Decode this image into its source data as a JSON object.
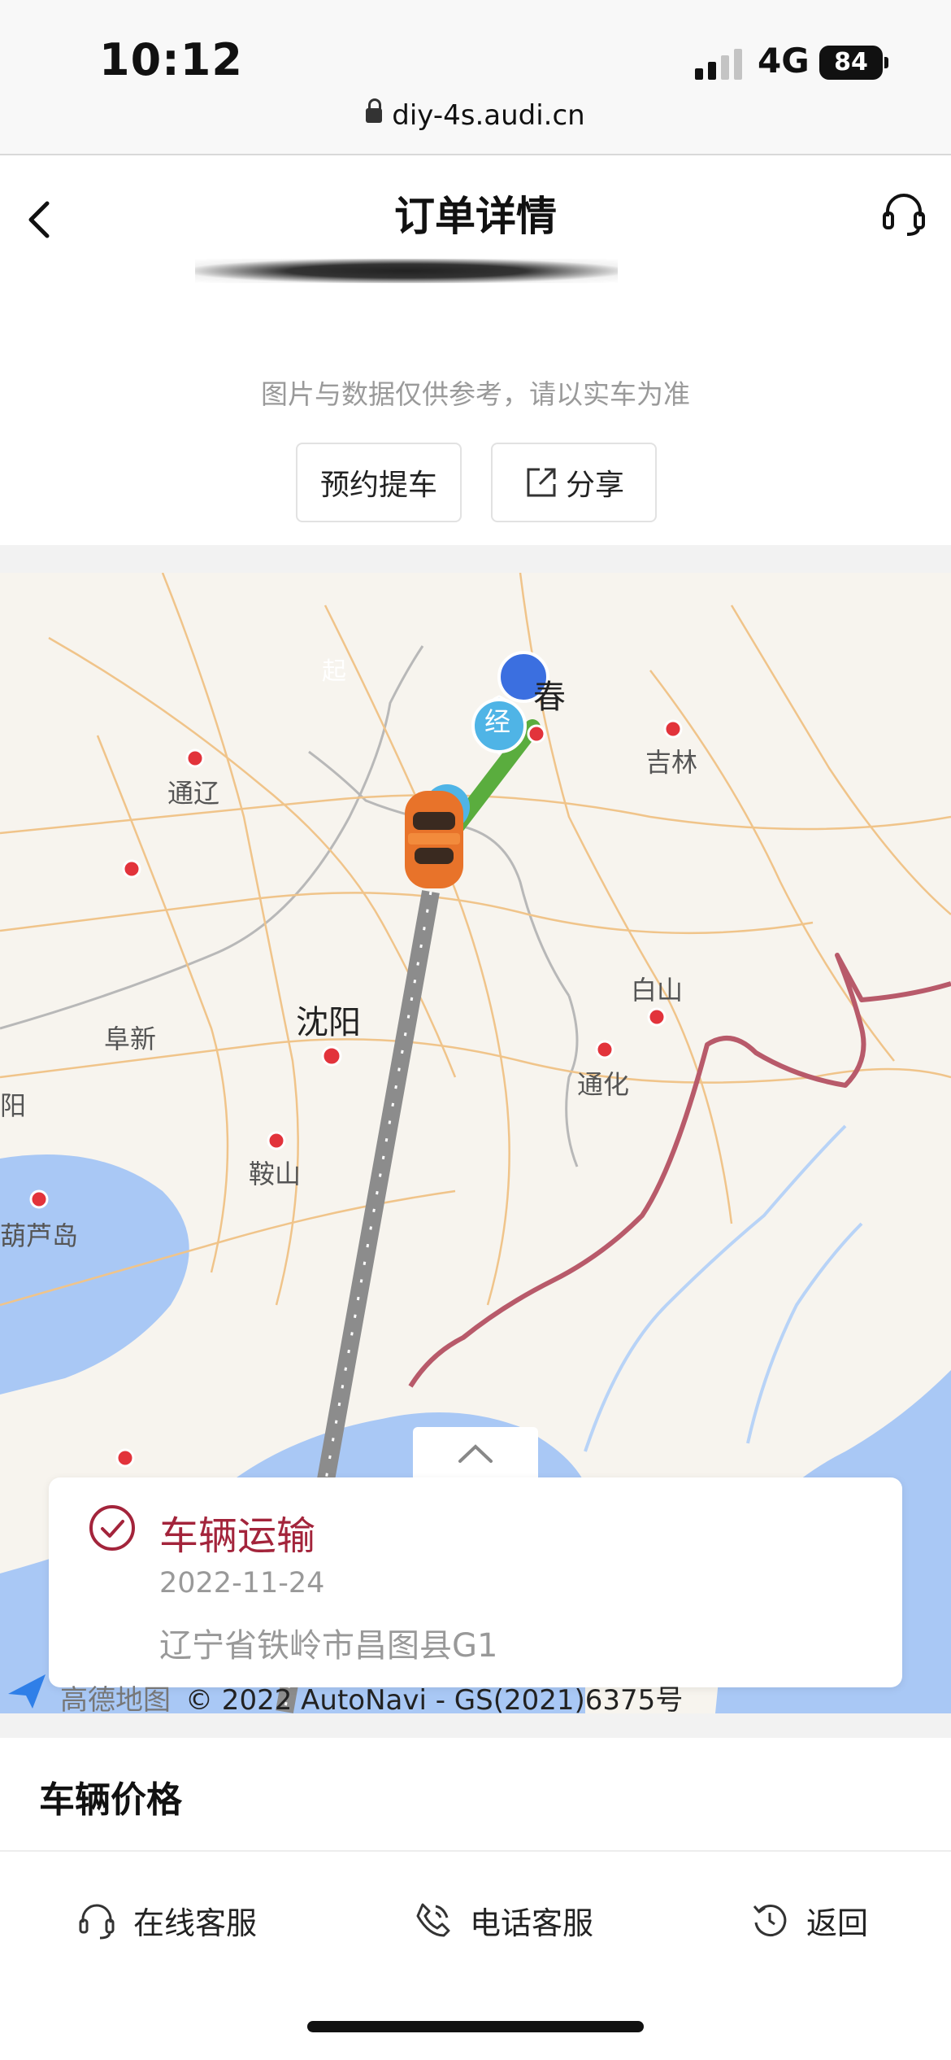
{
  "status_bar": {
    "time": "10:12",
    "network": "4G",
    "battery": "84"
  },
  "browser": {
    "url": "diy-4s.audi.cn"
  },
  "nav": {
    "title": "订单详情"
  },
  "vehicle": {
    "disclaimer": "图片与数据仅供参考，请以实车为准",
    "reserve_label": "预约提车",
    "share_label": "分享"
  },
  "map": {
    "cities": {
      "changchun": "春",
      "jilin": "吉林",
      "tongliao": "通辽",
      "shenyang": "沈阳",
      "fuxin": "阜新",
      "baishan": "白山",
      "tonghua": "通化",
      "anshan": "鞍山",
      "huludao": "葫芦岛",
      "partial_left": "阳"
    },
    "markers": {
      "start": "起",
      "via": "经"
    },
    "copyright": "© 2022 AutoNavi - GS(2021)6375号",
    "brand": "高德地图"
  },
  "status_card": {
    "title": "车辆运输",
    "date": "2022-11-24",
    "location": "辽宁省铁岭市昌图县G1"
  },
  "section": {
    "title": "车辆价格"
  },
  "bottom_bar": {
    "online_service": "在线客服",
    "phone_service": "电话客服",
    "back": "返回"
  },
  "colors": {
    "accent": "#a3243b",
    "route_green": "#5aad3e",
    "route_gray": "#8c8c8c",
    "sea": "#a9c8f5",
    "border": "#b85a6a"
  }
}
